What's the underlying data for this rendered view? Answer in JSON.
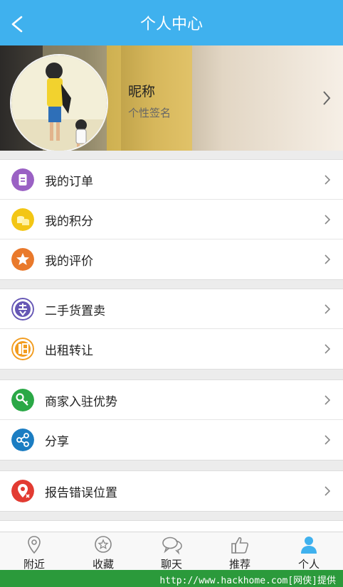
{
  "header": {
    "title": "个人中心"
  },
  "profile": {
    "nickname": "昵称",
    "signature": "个性签名"
  },
  "groups": [
    [
      {
        "label": "我的订单",
        "icon": "order-icon",
        "color": "#9a61c4"
      },
      {
        "label": "我的积分",
        "icon": "coins-icon",
        "color": "#f3c614"
      },
      {
        "label": "我的评价",
        "icon": "star-icon",
        "color": "#e9792b"
      }
    ],
    [
      {
        "label": "二手货置卖",
        "icon": "sell-icon",
        "color": "#6657b5"
      },
      {
        "label": "出租转让",
        "icon": "rent-icon",
        "color": "#f29c1f"
      }
    ],
    [
      {
        "label": "商家入驻优势",
        "icon": "key-icon",
        "color": "#2aa846"
      },
      {
        "label": "分享",
        "icon": "share-icon",
        "color": "#1b7dc2"
      }
    ],
    [
      {
        "label": "报告错误位置",
        "icon": "location-error-icon",
        "color": "#e23b32"
      }
    ]
  ],
  "tabs": [
    {
      "label": "附近",
      "icon": "location-pin-icon"
    },
    {
      "label": "收藏",
      "icon": "favorite-star-icon"
    },
    {
      "label": "聊天",
      "icon": "chat-bubbles-icon"
    },
    {
      "label": "推荐",
      "icon": "thumbs-up-icon"
    },
    {
      "label": "个人",
      "icon": "person-icon",
      "active": true
    }
  ],
  "footer": {
    "text": "http://www.hackhome.com[网侠]提供"
  },
  "colors": {
    "accent": "#3fb1ee",
    "tab_active": "#3fb1ee",
    "footer": "#2b9a3b"
  }
}
